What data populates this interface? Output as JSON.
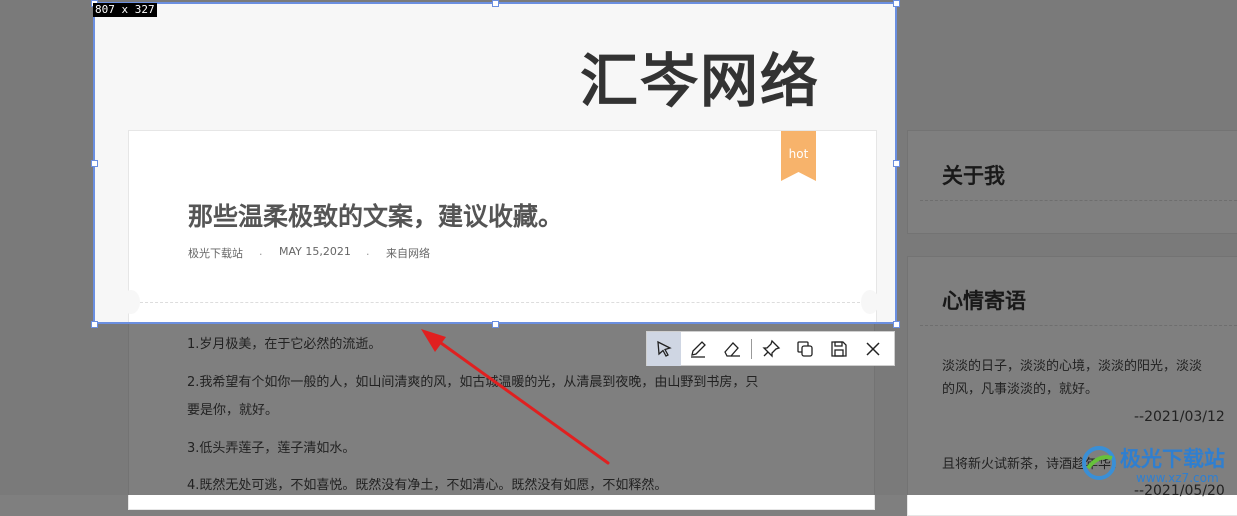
{
  "overlay": {
    "size_label": "807 x 327"
  },
  "site": {
    "title": "汇岑网络"
  },
  "post": {
    "badge": "hot",
    "title": "那些温柔极致的文案，建议收藏。",
    "meta": {
      "author": "极光下载站",
      "sep": ".",
      "date": "MAY 15,2021",
      "source": "来自网络"
    },
    "lines": [
      "1.岁月极美，在于它必然的流逝。",
      "2.我希望有个如你一般的人，如山间清爽的风，如古城温暖的光，从清晨到夜晚，由山野到书房，只",
      "要是你，就好。",
      "3.低头弄莲子，莲子清如水。",
      "4.既然无处可逃，不如喜悦。既然没有净土，不如清心。既然没有如愿，不如释然。"
    ]
  },
  "sidebar": {
    "about_title": "关于我",
    "mood_title": "心情寄语",
    "mood_text_1": "淡淡的日子，淡淡的心境，淡淡的阳光，淡淡",
    "mood_text_2": "的风，凡事淡淡的，就好。",
    "mood_date_1": "--2021/03/12",
    "mood_text_3": "且将新火试新茶，诗酒趁年华。",
    "mood_date_2": "--2021/05/20"
  },
  "watermark": {
    "text": "极光下载站",
    "url": "www.xz7.com"
  },
  "toolbar": {
    "icons": [
      "select-arrow-icon",
      "pen-icon",
      "eraser-icon",
      "pin-icon",
      "copy-icon",
      "save-icon",
      "close-icon"
    ]
  },
  "colors": {
    "selection_border": "#6b8fe0",
    "badge": "#f7b36b",
    "arrow": "#e02020"
  }
}
